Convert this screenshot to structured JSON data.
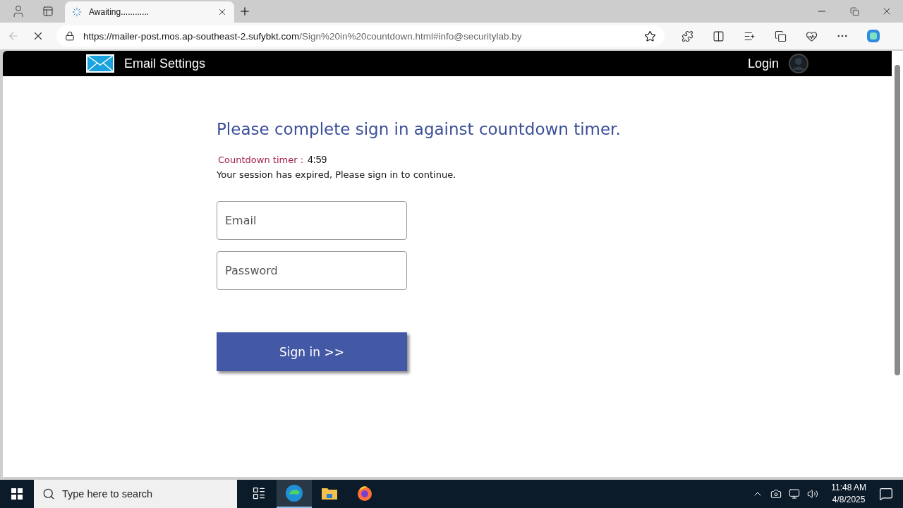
{
  "browser": {
    "tab": {
      "title": "Awaiting............",
      "selected": true,
      "loading": true
    },
    "address": {
      "host": "https://mailer-post.mos.ap-southeast-2.sufybkt.com",
      "path": "/Sign%20in%20countdown.html#info@securitylab.by"
    }
  },
  "header": {
    "title": "Email Settings",
    "login": "Login"
  },
  "heading": "Please complete sign in against countdown timer.",
  "countdown": {
    "label": "Countdown timer :",
    "value": "4:59"
  },
  "message": "Your session has expired, Please sign in to continue.",
  "fields": [
    {
      "placeholder": "Email"
    },
    {
      "placeholder": "Password"
    }
  ],
  "button": "Sign in >>",
  "taskbar": {
    "search": {
      "placeholder": "Type here to search"
    },
    "apps": [
      {
        "kind": "taskview",
        "active": false
      },
      {
        "kind": "edge",
        "active": true
      },
      {
        "kind": "files",
        "active": false
      },
      {
        "kind": "firefox",
        "active": false
      }
    ],
    "clock": {
      "time": "11:48 AM",
      "date": "4/8/2025"
    }
  }
}
